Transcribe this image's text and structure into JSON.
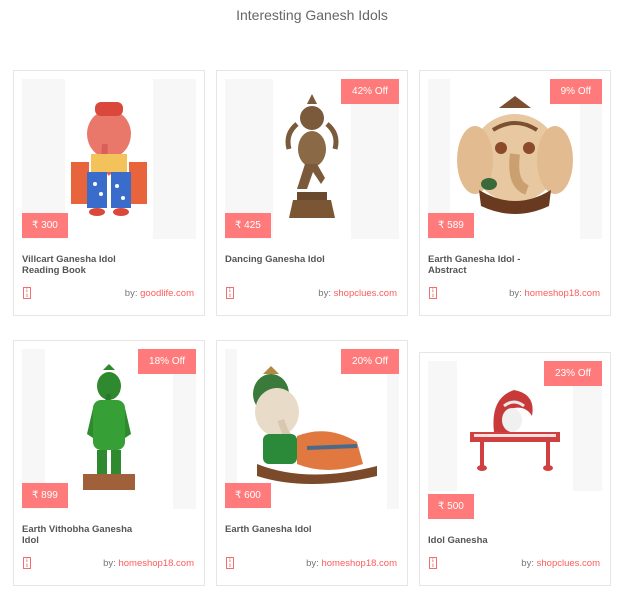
{
  "page": {
    "title": "Interesting Ganesh Idols"
  },
  "by_label": "by:",
  "products": [
    {
      "name": "Villcart Ganesha Idol Reading Book",
      "price": "₹ 300",
      "discount": "",
      "source": "goodlife.com",
      "icon": "ganesha-reading-image"
    },
    {
      "name": "Dancing Ganesha Idol",
      "price": "₹ 425",
      "discount": "42% Off",
      "source": "shopclues.com",
      "icon": "ganesha-dancing-image"
    },
    {
      "name": "Earth Ganesha Idol - Abstract",
      "price": "₹ 589",
      "discount": "9% Off",
      "source": "homeshop18.com",
      "icon": "ganesha-abstract-image"
    },
    {
      "name": "Earth Vithobha Ganesha Idol",
      "price": "₹ 899",
      "discount": "18% Off",
      "source": "homeshop18.com",
      "icon": "ganesha-vithobha-image"
    },
    {
      "name": "Earth Ganesha Idol",
      "price": "₹ 600",
      "discount": "20% Off",
      "source": "homeshop18.com",
      "icon": "ganesha-reclining-image"
    },
    {
      "name": "Idol Ganesha",
      "price": "₹ 500",
      "discount": "23% Off",
      "source": "shopclues.com",
      "icon": "ganesha-bench-image"
    }
  ]
}
